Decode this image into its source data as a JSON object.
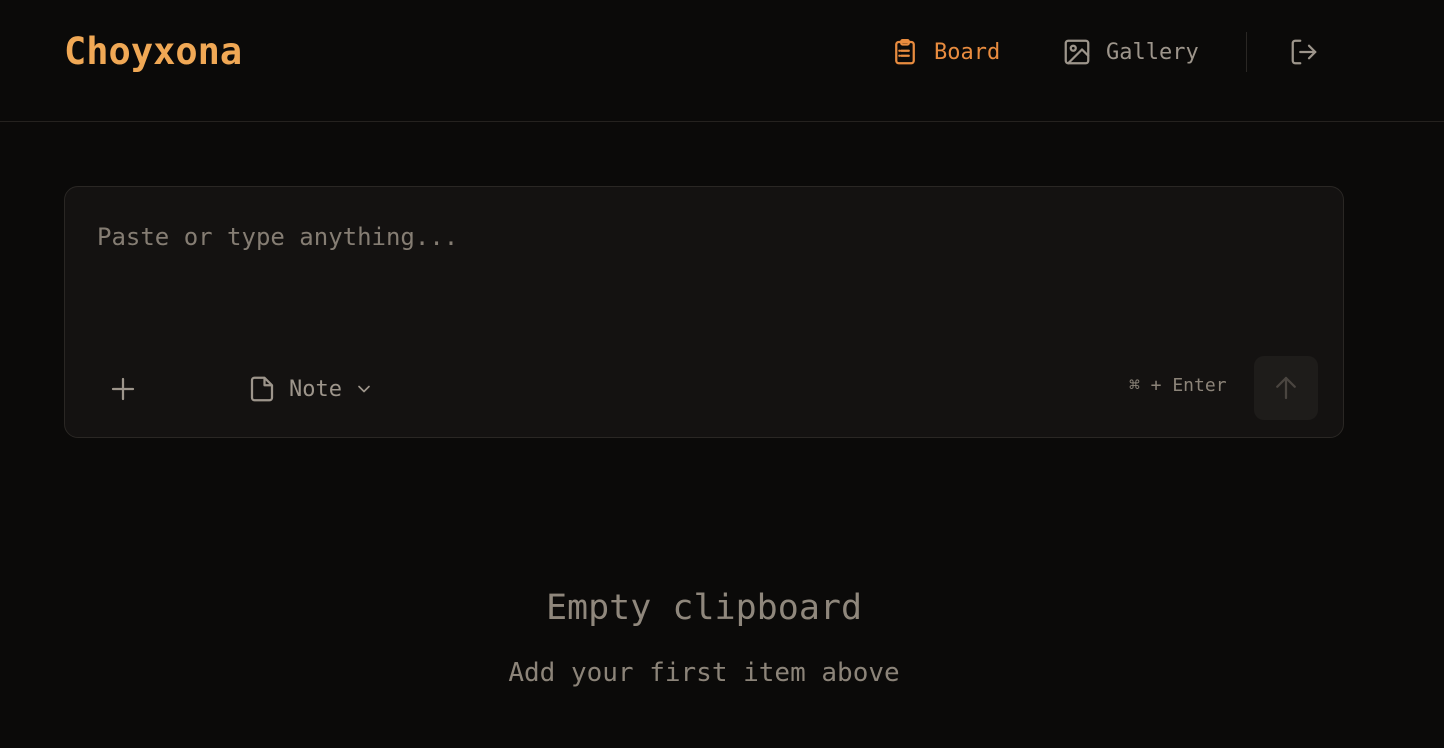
{
  "app": {
    "title": "Choyxona"
  },
  "nav": {
    "board_label": "Board",
    "board_icon": "clipboard-icon",
    "gallery_label": "Gallery",
    "gallery_icon": "image-icon",
    "logout_icon": "logout-icon"
  },
  "composer": {
    "placeholder": "Paste or type anything...",
    "value": "",
    "type_label": "Note",
    "type_icon": "file-icon",
    "shortcut": "⌘ + Enter",
    "add_icon": "plus-icon",
    "send_icon": "arrow-up-icon"
  },
  "empty_state": {
    "title": "Empty clipboard",
    "subtitle": "Add your first item above"
  },
  "colors": {
    "accent": "#f0a855",
    "active_nav": "#e98c3f",
    "background": "#0b0a09",
    "panel": "#141211"
  }
}
